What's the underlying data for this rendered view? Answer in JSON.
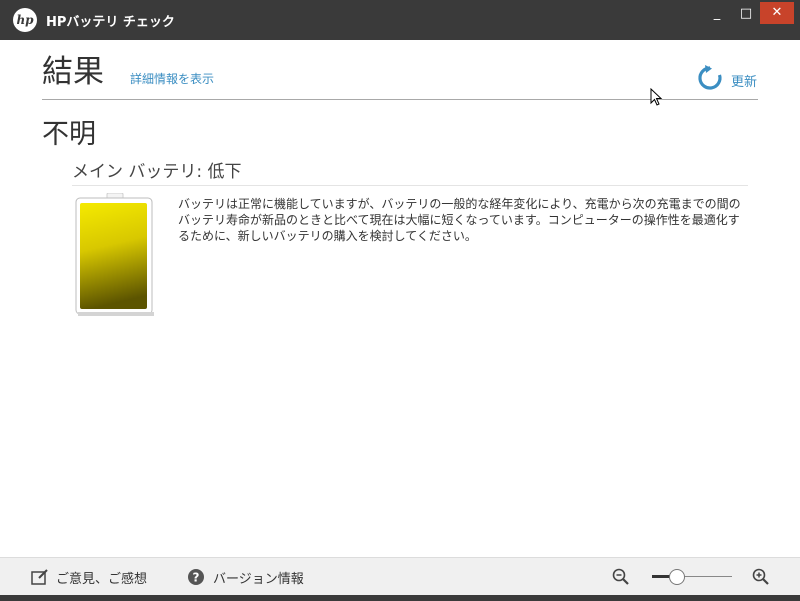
{
  "window": {
    "title": "HPバッテリ チェック",
    "logo_text": "hp",
    "minimize_label": "_",
    "maximize_label": "□",
    "close_label": "✕"
  },
  "header": {
    "title": "結果",
    "details_link": "詳細情報を表示",
    "refresh_label": "更新",
    "refresh_icon": "refresh-icon"
  },
  "result": {
    "status": "不明",
    "battery_heading": "メイン バッテリ: 低下",
    "description": "バッテリは正常に機能していますが、バッテリの一般的な経年変化により、充電から次の充電までの間のバッテリ寿命が新品のときと比べて現在は大幅に短くなっています。コンピューターの操作性を最適化するために、新しいバッテリの購入を検討してください。",
    "battery_color": "#e8d800"
  },
  "footer": {
    "feedback_label": "ご意見、ご感想",
    "version_label": "バージョン情報",
    "zoom_out_icon": "zoom-out-icon",
    "zoom_in_icon": "zoom-in-icon"
  },
  "colors": {
    "titlebar": "#3a3a3a",
    "close": "#c8432a",
    "accent": "#3b8ec2"
  }
}
